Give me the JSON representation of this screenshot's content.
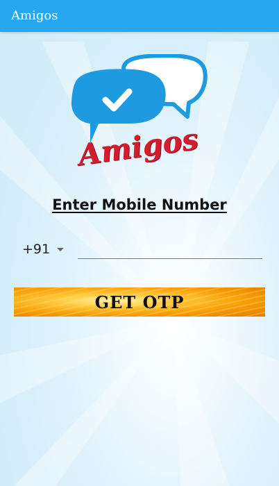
{
  "app_bar": {
    "title": "Amigos"
  },
  "logo": {
    "wordmark": "Amigos",
    "icon": "chat-bubbles-check-icon",
    "bubble_color": "#1e9ae0",
    "wordmark_color": "#d31c2d"
  },
  "form": {
    "heading": "Enter Mobile Number",
    "country_code": "+91",
    "phone_value": "",
    "phone_placeholder": ""
  },
  "button": {
    "label": "GET OTP"
  },
  "colors": {
    "app_bar": "#26a7ef",
    "button_orange": "#f9a50d"
  }
}
